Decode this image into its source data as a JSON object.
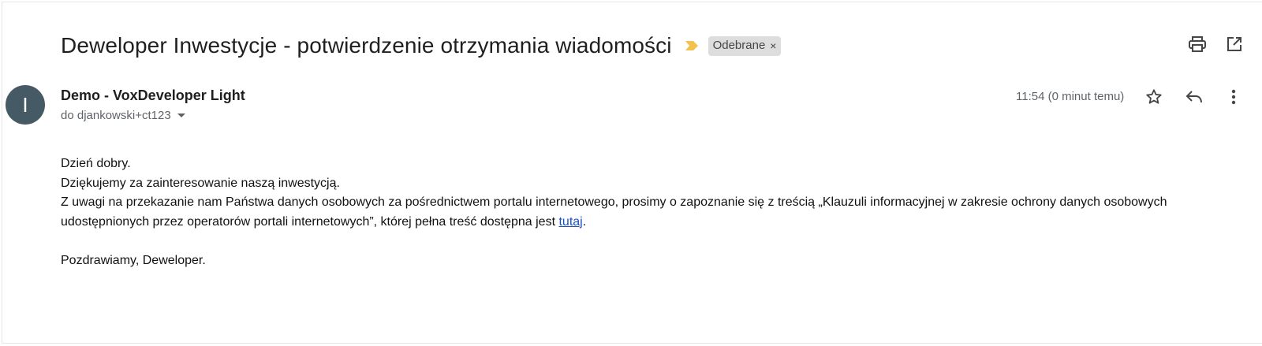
{
  "email": {
    "subject": "Deweloper Inwestycje - potwierdzenie otrzymania wiadomości",
    "label": "Odebrane",
    "sender": {
      "avatar_initial": "I",
      "name": "Demo - VoxDeveloper Light",
      "recipient_text": "do djankowski+ct123"
    },
    "time": "11:54 (0 minut temu)",
    "body": {
      "greeting": "Dzień dobry.",
      "thanks": "Dziękujemy za zainteresowanie naszą inwestycją.",
      "paragraph_before_link": "Z uwagi na przekazanie nam Państwa danych osobowych za pośrednictwem portalu internetowego, prosimy o zapoznanie się z treścią „Klauzuli informacyjnej w zakresie ochrony danych osobowych udostępnionych przez operatorów portali internetowych”, której pełna treść dostępna jest ",
      "link_text": "tutaj",
      "paragraph_after_link": ".",
      "signature": "Pozdrawiamy, Deweloper."
    }
  },
  "icons": {
    "importance": "importance-marker-icon",
    "print": "print-icon",
    "open_new_window": "open-in-new-window-icon",
    "star": "star-icon",
    "reply": "reply-icon",
    "more": "more-vertical-icon"
  },
  "colors": {
    "avatar_bg": "#455a64",
    "importance": "#f2c14e",
    "link": "#1a4fc4",
    "label_chip_bg": "#dddddd"
  }
}
